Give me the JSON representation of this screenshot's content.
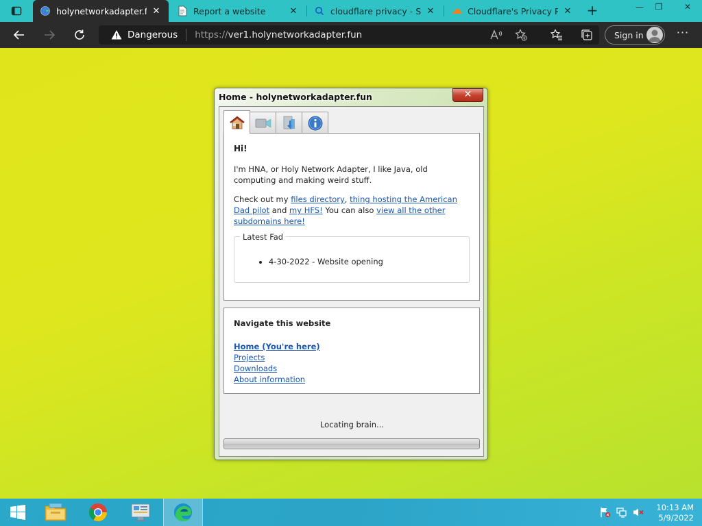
{
  "browser": {
    "tabs": [
      {
        "title": "holynetworkadapter.fun",
        "active": true
      },
      {
        "title": "Report a website",
        "active": false
      },
      {
        "title": "cloudflare privacy - Searc",
        "active": false
      },
      {
        "title": "Cloudflare's Privacy Polic",
        "active": false
      }
    ],
    "tab_close_glyph": "✕",
    "new_tab_glyph": "+",
    "window_controls": {
      "minimize": "—",
      "restore": "❐",
      "close": "✕"
    },
    "security_label": "Dangerous",
    "url_scheme": "https://",
    "url_host": "ver1.holynetworkadapter.fun",
    "sign_in_label": "Sign in",
    "more_glyph": "···",
    "colors": {
      "tabbar": "#2fc3c6",
      "toolbar": "#2b2b2b",
      "active_tab": "#2b2b2b"
    }
  },
  "app_window": {
    "title": "Home - holynetworkadapter.fun",
    "close_glyph": "✕",
    "tab_icons": [
      "house-icon",
      "video-icon",
      "download-icon",
      "info-icon"
    ],
    "home": {
      "greeting": "Hi!",
      "intro": "I'm HNA, or Holy Network Adapter, I like Java, old computing and making weird stuff.",
      "check_prefix": "Check out my ",
      "link_files": "files directory",
      "comma": ", ",
      "link_american_dad": "thing hosting the American Dad pilot",
      "and_text": " and ",
      "link_hfs": "my HFS!",
      "also_text": " You can also ",
      "link_subdomains": "view all the other subdomains here!",
      "latest_legend": "Latest Fad",
      "latest_items": [
        "4-30-2022 - Website opening"
      ]
    },
    "nav": {
      "title": "Navigate this website",
      "links": [
        "Home (You're here)",
        "Projects",
        "Downloads",
        "About information"
      ]
    },
    "status_text": "Locating brain...",
    "progress_fraction": 0
  },
  "taskbar": {
    "apps": [
      "file-explorer-icon",
      "chrome-icon",
      "control-panel-icon",
      "edge-icon"
    ],
    "clock_time": "10:13 AM",
    "clock_date": "5/9/2022",
    "colors": {
      "bar": "#2aa7c9"
    }
  }
}
